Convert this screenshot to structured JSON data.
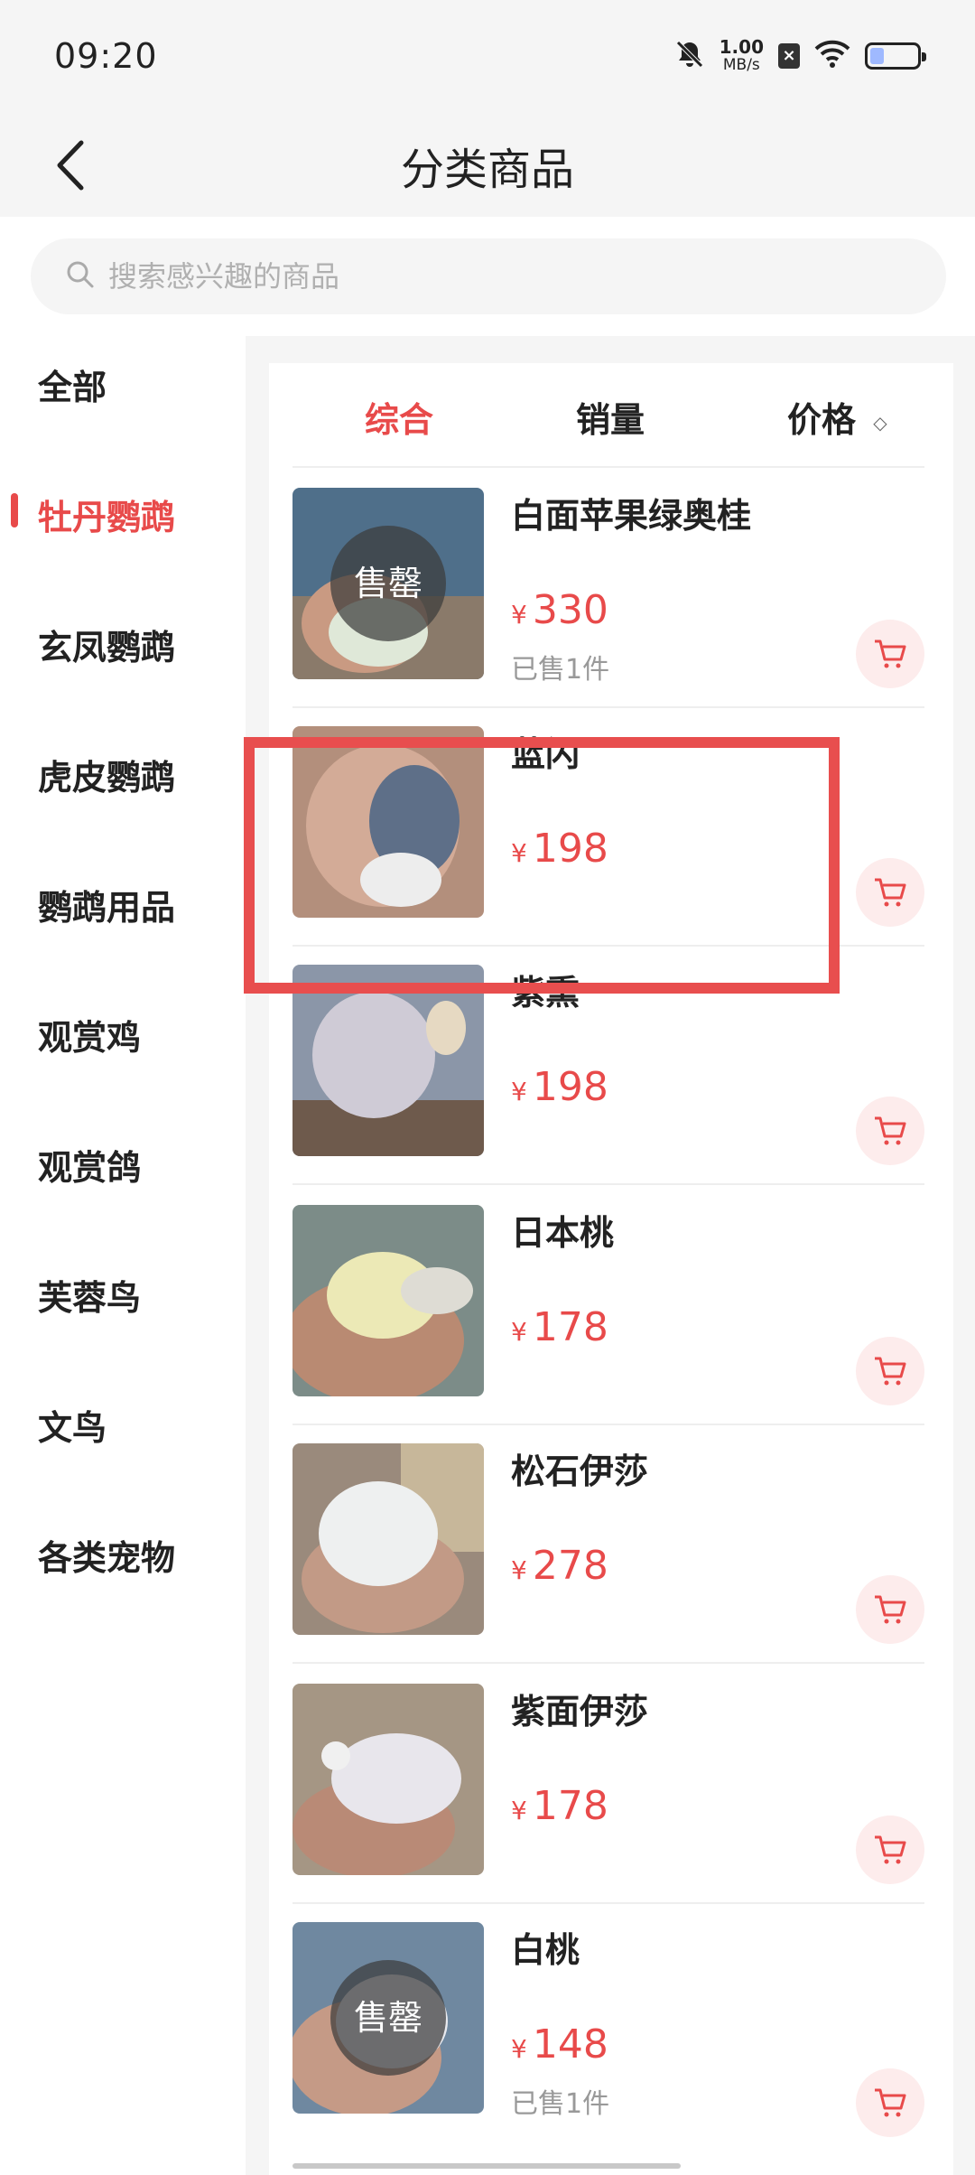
{
  "status_bar": {
    "time": "09:20",
    "net_speed_value": "1.00",
    "net_speed_unit": "MB/s",
    "battery_level": 0.3,
    "icons": [
      "mute-icon",
      "close-box-icon",
      "wifi-icon",
      "battery-icon"
    ]
  },
  "header": {
    "title": "分类商品",
    "back_icon": "chevron-left-icon"
  },
  "search": {
    "placeholder": "搜索感兴趣的商品",
    "icon": "search-icon"
  },
  "sidebar": {
    "active_index": 1,
    "active_color": "#e84a4a",
    "items": [
      {
        "label": "全部"
      },
      {
        "label": "牡丹鹦鹉"
      },
      {
        "label": "玄凤鹦鹉"
      },
      {
        "label": "虎皮鹦鹉"
      },
      {
        "label": "鹦鹉用品"
      },
      {
        "label": "观赏鸡"
      },
      {
        "label": "观赏鸽"
      },
      {
        "label": "芙蓉鸟"
      },
      {
        "label": "文鸟"
      },
      {
        "label": "各类宠物"
      }
    ]
  },
  "sort_tabs": {
    "active_index": 0,
    "items": [
      {
        "label": "综合"
      },
      {
        "label": "销量"
      },
      {
        "label": "价格"
      }
    ]
  },
  "products": [
    {
      "name": "白面苹果绿奥桂",
      "currency": "¥",
      "price": "330",
      "sold": "已售1件",
      "overlay": "售罄"
    },
    {
      "name": "蓝闪",
      "currency": "¥",
      "price": "198",
      "sold": "",
      "overlay": ""
    },
    {
      "name": "紫熏",
      "currency": "¥",
      "price": "198",
      "sold": "",
      "overlay": ""
    },
    {
      "name": "日本桃",
      "currency": "¥",
      "price": "178",
      "sold": "",
      "overlay": ""
    },
    {
      "name": "松石伊莎",
      "currency": "¥",
      "price": "278",
      "sold": "",
      "overlay": ""
    },
    {
      "name": "紫面伊莎",
      "currency": "¥",
      "price": "178",
      "sold": "",
      "overlay": ""
    },
    {
      "name": "白桃",
      "currency": "¥",
      "price": "148",
      "sold": "已售1件",
      "overlay": "售罄"
    }
  ],
  "colors": {
    "accent": "#e84a4a",
    "highlight_box": "#e84e4e",
    "background": "#f5f5f5"
  }
}
